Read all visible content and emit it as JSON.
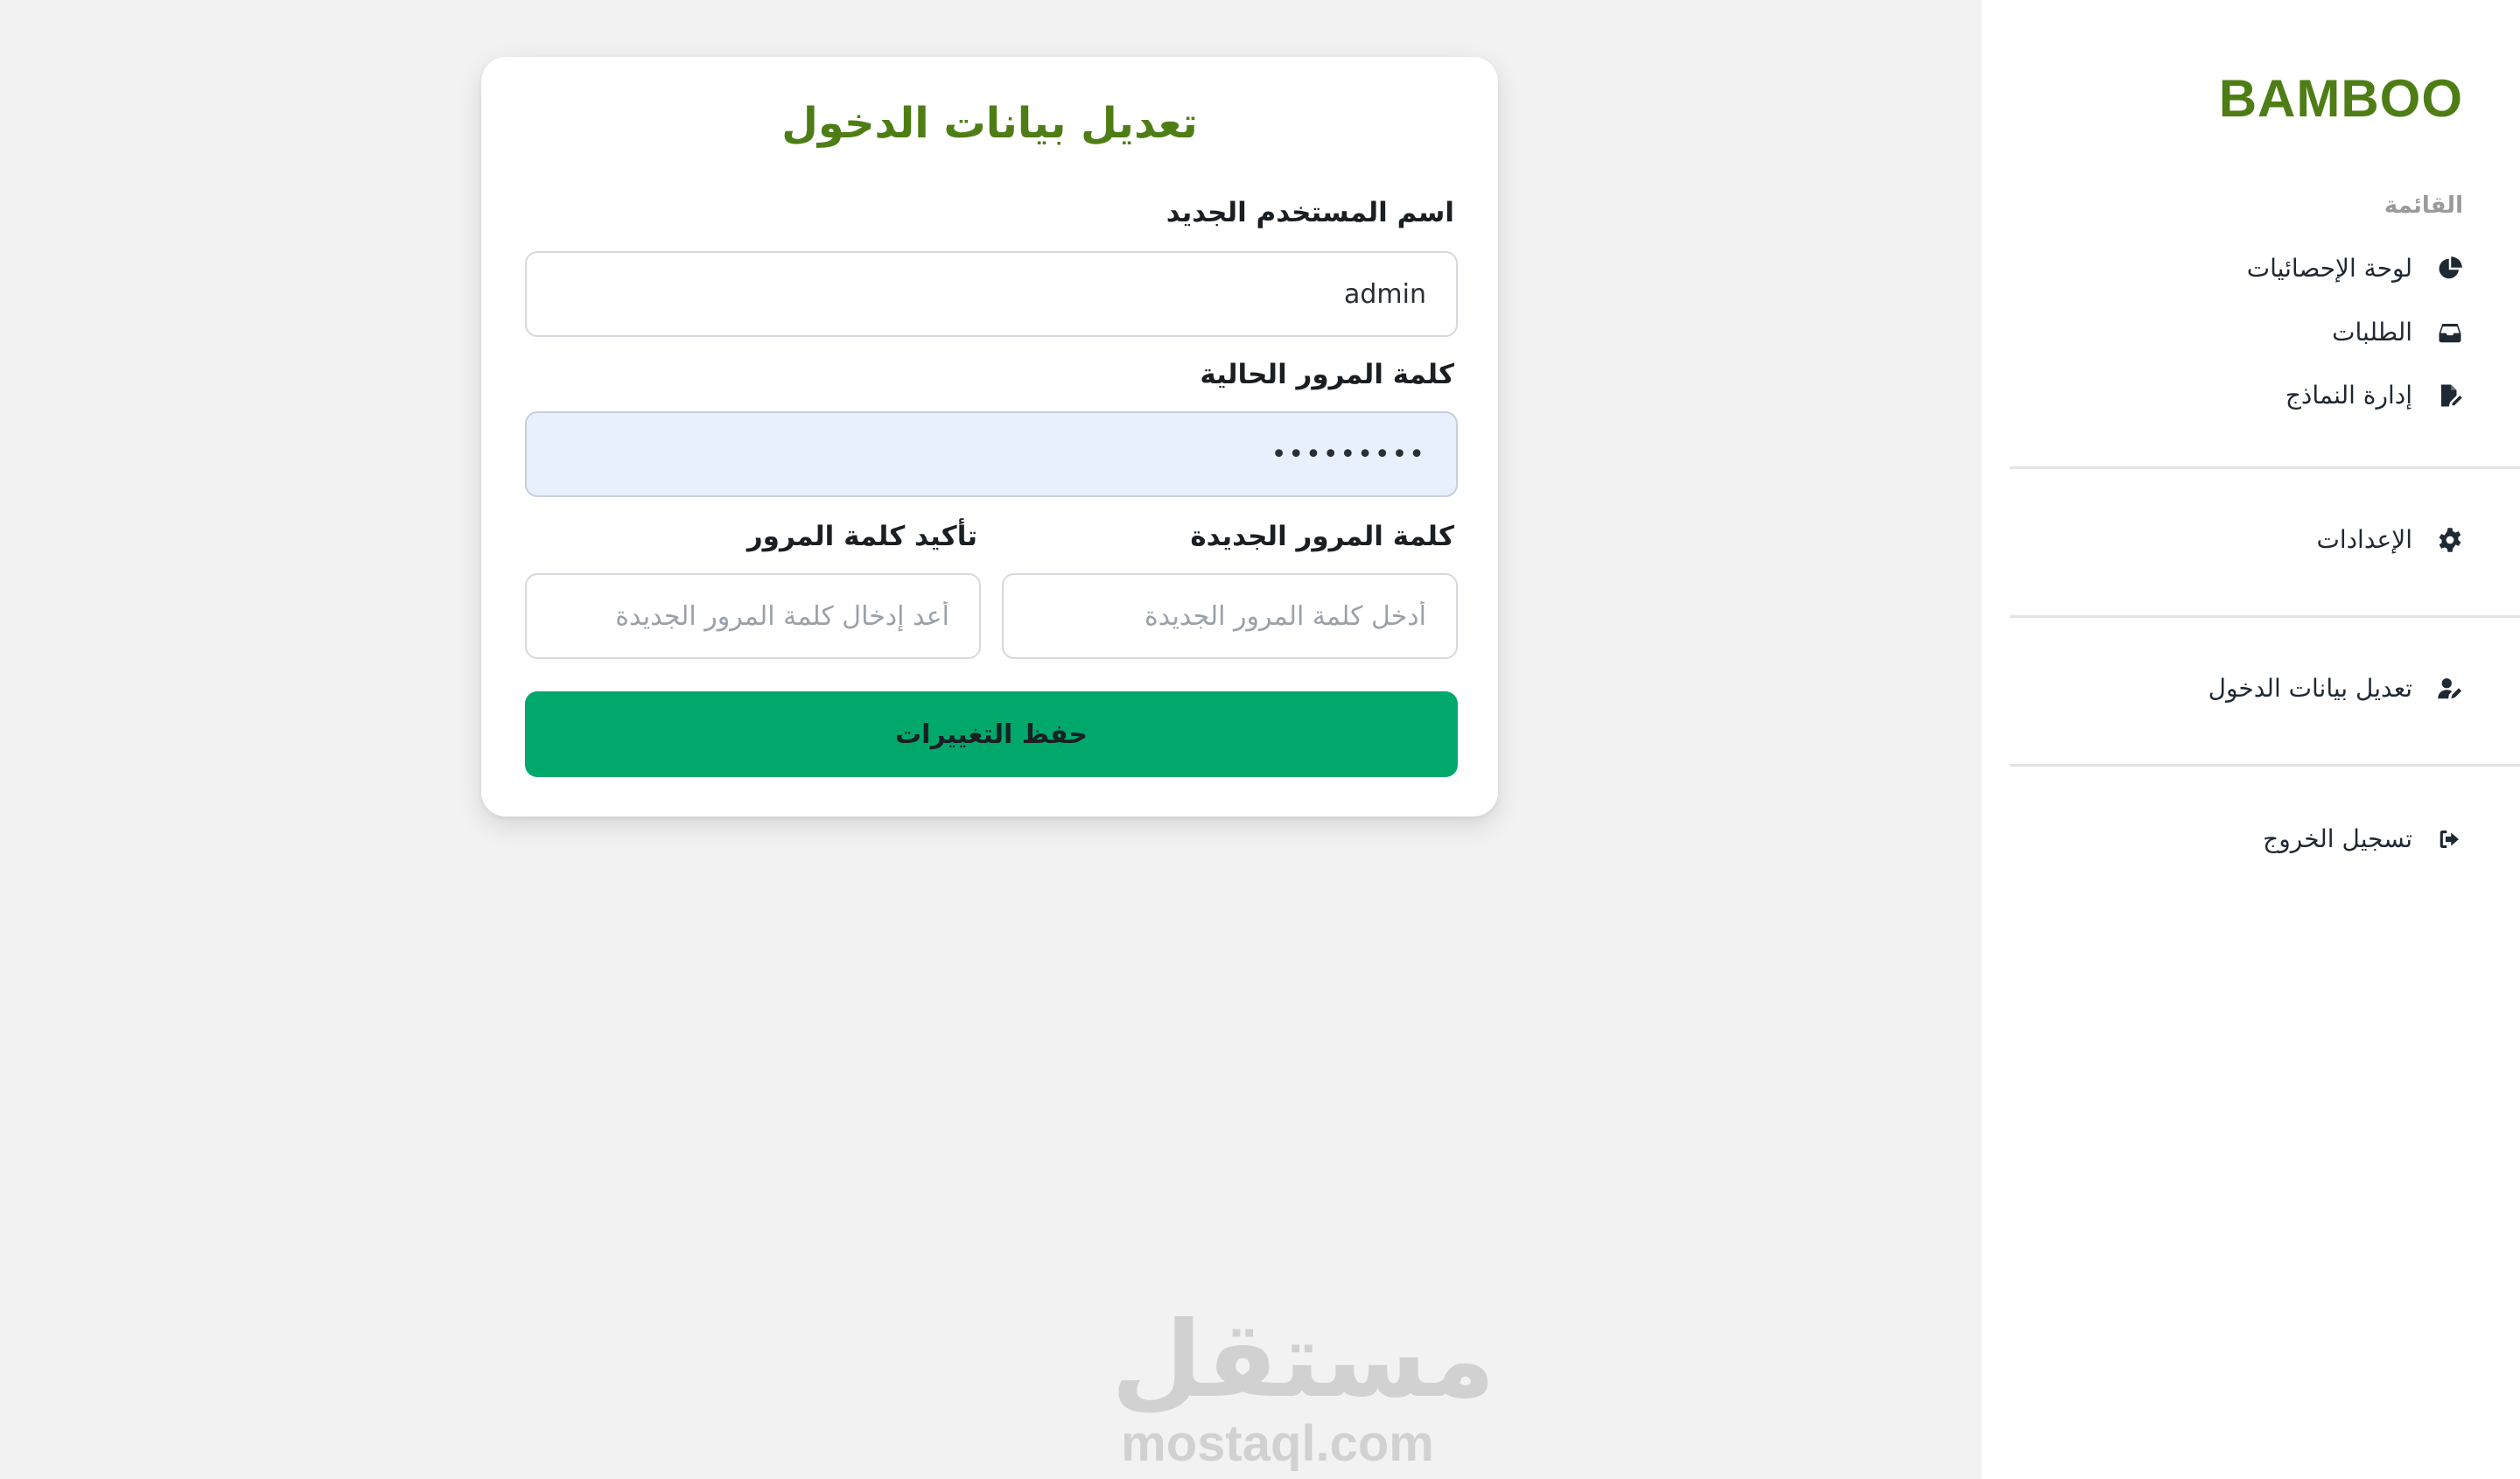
{
  "brand": {
    "name": "BAMBOO",
    "color": "#4e7d15"
  },
  "sidebar": {
    "menu_heading": "القائمة",
    "items": [
      {
        "label": "لوحة الإحصائيات",
        "icon": "pie-chart-icon"
      },
      {
        "label": "الطلبات",
        "icon": "inbox-icon"
      },
      {
        "label": "إدارة النماذج",
        "icon": "file-edit-icon"
      },
      {
        "label": "الإعدادات",
        "icon": "gear-icon"
      },
      {
        "label": "تعديل بيانات الدخول",
        "icon": "user-edit-icon"
      },
      {
        "label": "تسجيل الخروج",
        "icon": "logout-icon"
      }
    ]
  },
  "form": {
    "title": "تعديل بيانات الدخول",
    "username_label": "اسم المستخدم الجديد",
    "username_value": "admin",
    "current_password_label": "كلمة المرور الحالية",
    "current_password_value": "•••••••••",
    "new_password_label": "كلمة المرور الجديدة",
    "new_password_placeholder": "أدخل كلمة المرور الجديدة",
    "confirm_password_label": "تأكيد كلمة المرور",
    "confirm_password_placeholder": "أعد إدخال كلمة المرور الجديدة",
    "save_button": "حفظ التغييرات",
    "button_color": "#00a86b"
  },
  "watermark": {
    "arabic": "مستقل",
    "latin": "mostaql.com"
  }
}
